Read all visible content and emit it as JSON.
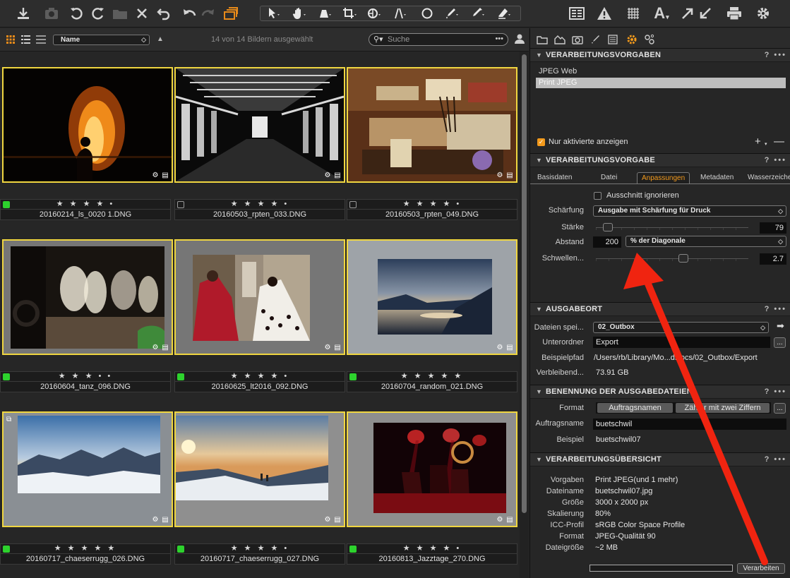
{
  "toolbar": {
    "left_icons": [
      "import-icon",
      "camera-icon",
      "rotate-left-icon",
      "rotate-right-icon",
      "folder-icon",
      "delete-icon",
      "reset-icon",
      "undo-icon",
      "redo-icon",
      "stack-icon"
    ],
    "tool_icons": [
      "cursor-tool-icon",
      "pan-tool-icon",
      "loupe-tool-icon",
      "crop-tool-icon",
      "rotate-tool-icon",
      "keystone-tool-icon",
      "circle-tool-icon",
      "brush-tool-icon",
      "picker-tool-icon",
      "erase-tool-icon"
    ],
    "right_icons": [
      "grid-view-icon",
      "warning-icon",
      "exposure-icon",
      "text-icon",
      "expand-icon",
      "print-icon",
      "settings-icon"
    ],
    "text_tool_glyph": "A",
    "accent": "#e78a1a"
  },
  "browser": {
    "sort_field": "Name",
    "count_text": "14 von 14 Bildern ausgewählt",
    "search_placeholder": "Suche",
    "thumbnails": [
      {
        "filename": "20160214_ls_0020 1.DNG",
        "stars": "★ ★ ★ ★ •",
        "tag": "green",
        "selected": true
      },
      {
        "filename": "20160503_rpten_033.DNG",
        "stars": "★ ★ ★ ★ •",
        "tag": "none",
        "selected": true
      },
      {
        "filename": "20160503_rpten_049.DNG",
        "stars": "★ ★ ★ ★ •",
        "tag": "none",
        "selected": true
      },
      {
        "filename": "20160604_tanz_096.DNG",
        "stars": "★ ★ ★ • •",
        "tag": "green",
        "selected": true
      },
      {
        "filename": "20160625_lt2016_092.DNG",
        "stars": "★ ★ ★ ★ •",
        "tag": "green",
        "selected": true
      },
      {
        "filename": "20160704_random_021.DNG",
        "stars": "★ ★ ★ ★ ★",
        "tag": "green",
        "selected": true
      },
      {
        "filename": "20160717_chaeserrugg_026.DNG",
        "stars": "★ ★ ★ ★ ★",
        "tag": "green",
        "selected": true
      },
      {
        "filename": "20160717_chaeserrugg_027.DNG",
        "stars": "★ ★ ★ ★ •",
        "tag": "green",
        "selected": true
      },
      {
        "filename": "20160813_Jazztage_270.DNG",
        "stars": "★ ★ ★ ★ •",
        "tag": "green",
        "selected": true
      }
    ]
  },
  "recipes": {
    "title": "VERARBEITUNGSVORGABEN",
    "items": [
      "JPEG Web",
      "Print JPEG"
    ],
    "selected_item": "Print JPEG",
    "only_active_label": "Nur aktivierte anzeigen",
    "only_active_checked": true
  },
  "recipe": {
    "title": "VERARBEITUNGSVORGABE",
    "tabs": [
      "Basisdaten",
      "Datei",
      "Anpassungen",
      "Metadaten",
      "Wasserzeichen"
    ],
    "active_tab": "Anpassungen",
    "ignore_crop_label": "Ausschnitt ignorieren",
    "ignore_crop_checked": false,
    "sharpening_label": "Schärfung",
    "sharpening_value": "Ausgabe mit Schärfung für Druck",
    "amount_label": "Stärke",
    "amount_value": "79",
    "amount_fraction": 0.05,
    "distance_label": "Abstand",
    "distance_value": "200",
    "distance_unit": "% der Diagonale",
    "threshold_label": "Schwellen...",
    "threshold_value": "2.7",
    "threshold_fraction": 0.58
  },
  "output_location": {
    "title": "AUSGABEORT",
    "destination_label": "Dateien spei...",
    "destination_value": "02_Outbox",
    "subfolder_label": "Unterordner",
    "subfolder_value": "Export",
    "sample_label": "Beispielpfad",
    "sample_value": "/Users/rb/Library/Mo...dDocs/02_Outbox/Export",
    "remaining_label": "Verbleibend...",
    "remaining_value": "73.91 GB"
  },
  "output_naming": {
    "title": "BENENNUNG DER AUSGABEDATEIEN",
    "format_label": "Format",
    "format_tokens": [
      "Auftragsnamen",
      "Zähler mit zwei Ziffern"
    ],
    "job_label": "Auftragsname",
    "job_value": "buetschwil",
    "sample_label": "Beispiel",
    "sample_value": "buetschwil07"
  },
  "summary": {
    "title": "VERARBEITUNGSÜBERSICHT",
    "rows": [
      {
        "label": "Vorgaben",
        "value": "Print JPEG(und 1 mehr)"
      },
      {
        "label": "Dateiname",
        "value": "buetschwil07.jpg"
      },
      {
        "label": "Größe",
        "value": "3000 x 2000 px"
      },
      {
        "label": "Skalierung",
        "value": "80%"
      },
      {
        "label": "ICC-Profil",
        "value": "sRGB Color Space Profile"
      },
      {
        "label": "Format",
        "value": "JPEG-Qualität 90"
      },
      {
        "label": "Dateigröße",
        "value": "~2 MB"
      }
    ],
    "process_button": "Verarbeiten",
    "progress_fraction": 0
  },
  "annotation": {
    "arrow_color": "#f02410"
  }
}
